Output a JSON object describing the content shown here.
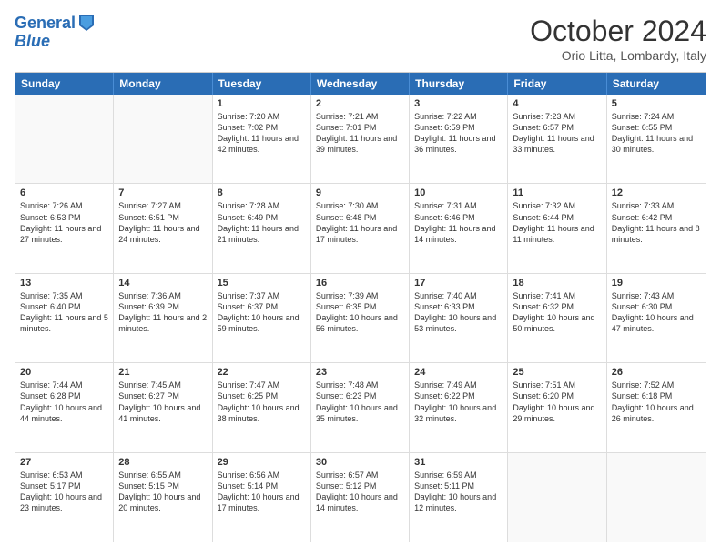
{
  "header": {
    "logo_line1": "General",
    "logo_line2": "Blue",
    "month": "October 2024",
    "location": "Orio Litta, Lombardy, Italy"
  },
  "days_of_week": [
    "Sunday",
    "Monday",
    "Tuesday",
    "Wednesday",
    "Thursday",
    "Friday",
    "Saturday"
  ],
  "rows": [
    [
      {
        "day": "",
        "text": "",
        "empty": true
      },
      {
        "day": "",
        "text": "",
        "empty": true
      },
      {
        "day": "1",
        "text": "Sunrise: 7:20 AM\nSunset: 7:02 PM\nDaylight: 11 hours and 42 minutes."
      },
      {
        "day": "2",
        "text": "Sunrise: 7:21 AM\nSunset: 7:01 PM\nDaylight: 11 hours and 39 minutes."
      },
      {
        "day": "3",
        "text": "Sunrise: 7:22 AM\nSunset: 6:59 PM\nDaylight: 11 hours and 36 minutes."
      },
      {
        "day": "4",
        "text": "Sunrise: 7:23 AM\nSunset: 6:57 PM\nDaylight: 11 hours and 33 minutes."
      },
      {
        "day": "5",
        "text": "Sunrise: 7:24 AM\nSunset: 6:55 PM\nDaylight: 11 hours and 30 minutes."
      }
    ],
    [
      {
        "day": "6",
        "text": "Sunrise: 7:26 AM\nSunset: 6:53 PM\nDaylight: 11 hours and 27 minutes."
      },
      {
        "day": "7",
        "text": "Sunrise: 7:27 AM\nSunset: 6:51 PM\nDaylight: 11 hours and 24 minutes."
      },
      {
        "day": "8",
        "text": "Sunrise: 7:28 AM\nSunset: 6:49 PM\nDaylight: 11 hours and 21 minutes."
      },
      {
        "day": "9",
        "text": "Sunrise: 7:30 AM\nSunset: 6:48 PM\nDaylight: 11 hours and 17 minutes."
      },
      {
        "day": "10",
        "text": "Sunrise: 7:31 AM\nSunset: 6:46 PM\nDaylight: 11 hours and 14 minutes."
      },
      {
        "day": "11",
        "text": "Sunrise: 7:32 AM\nSunset: 6:44 PM\nDaylight: 11 hours and 11 minutes."
      },
      {
        "day": "12",
        "text": "Sunrise: 7:33 AM\nSunset: 6:42 PM\nDaylight: 11 hours and 8 minutes."
      }
    ],
    [
      {
        "day": "13",
        "text": "Sunrise: 7:35 AM\nSunset: 6:40 PM\nDaylight: 11 hours and 5 minutes."
      },
      {
        "day": "14",
        "text": "Sunrise: 7:36 AM\nSunset: 6:39 PM\nDaylight: 11 hours and 2 minutes."
      },
      {
        "day": "15",
        "text": "Sunrise: 7:37 AM\nSunset: 6:37 PM\nDaylight: 10 hours and 59 minutes."
      },
      {
        "day": "16",
        "text": "Sunrise: 7:39 AM\nSunset: 6:35 PM\nDaylight: 10 hours and 56 minutes."
      },
      {
        "day": "17",
        "text": "Sunrise: 7:40 AM\nSunset: 6:33 PM\nDaylight: 10 hours and 53 minutes."
      },
      {
        "day": "18",
        "text": "Sunrise: 7:41 AM\nSunset: 6:32 PM\nDaylight: 10 hours and 50 minutes."
      },
      {
        "day": "19",
        "text": "Sunrise: 7:43 AM\nSunset: 6:30 PM\nDaylight: 10 hours and 47 minutes."
      }
    ],
    [
      {
        "day": "20",
        "text": "Sunrise: 7:44 AM\nSunset: 6:28 PM\nDaylight: 10 hours and 44 minutes."
      },
      {
        "day": "21",
        "text": "Sunrise: 7:45 AM\nSunset: 6:27 PM\nDaylight: 10 hours and 41 minutes."
      },
      {
        "day": "22",
        "text": "Sunrise: 7:47 AM\nSunset: 6:25 PM\nDaylight: 10 hours and 38 minutes."
      },
      {
        "day": "23",
        "text": "Sunrise: 7:48 AM\nSunset: 6:23 PM\nDaylight: 10 hours and 35 minutes."
      },
      {
        "day": "24",
        "text": "Sunrise: 7:49 AM\nSunset: 6:22 PM\nDaylight: 10 hours and 32 minutes."
      },
      {
        "day": "25",
        "text": "Sunrise: 7:51 AM\nSunset: 6:20 PM\nDaylight: 10 hours and 29 minutes."
      },
      {
        "day": "26",
        "text": "Sunrise: 7:52 AM\nSunset: 6:18 PM\nDaylight: 10 hours and 26 minutes."
      }
    ],
    [
      {
        "day": "27",
        "text": "Sunrise: 6:53 AM\nSunset: 5:17 PM\nDaylight: 10 hours and 23 minutes."
      },
      {
        "day": "28",
        "text": "Sunrise: 6:55 AM\nSunset: 5:15 PM\nDaylight: 10 hours and 20 minutes."
      },
      {
        "day": "29",
        "text": "Sunrise: 6:56 AM\nSunset: 5:14 PM\nDaylight: 10 hours and 17 minutes."
      },
      {
        "day": "30",
        "text": "Sunrise: 6:57 AM\nSunset: 5:12 PM\nDaylight: 10 hours and 14 minutes."
      },
      {
        "day": "31",
        "text": "Sunrise: 6:59 AM\nSunset: 5:11 PM\nDaylight: 10 hours and 12 minutes."
      },
      {
        "day": "",
        "text": "",
        "empty": true
      },
      {
        "day": "",
        "text": "",
        "empty": true
      }
    ]
  ]
}
